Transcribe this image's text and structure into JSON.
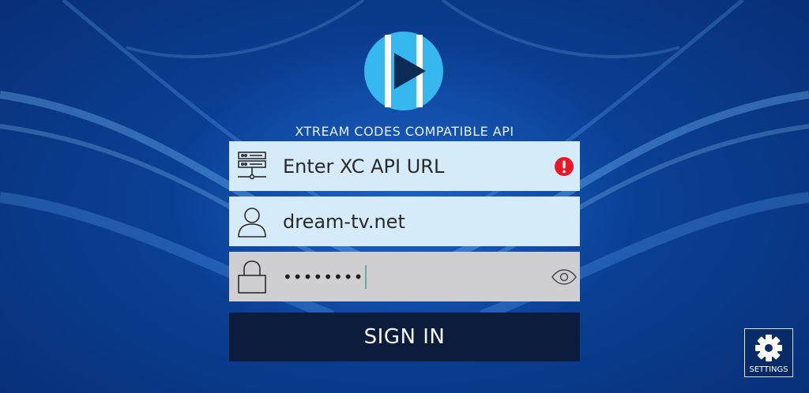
{
  "app": {
    "api_title": "XTREAM CODES COMPATIBLE API",
    "logo_icon": "play-logo-icon"
  },
  "fields": {
    "url": {
      "placeholder": "Enter XC API URL",
      "value": "",
      "icon": "server-icon",
      "status_icon": "error-icon"
    },
    "username": {
      "value": "dream-tv.net",
      "icon": "user-icon"
    },
    "password": {
      "masked_value": "••••••••",
      "icon": "lock-icon",
      "toggle_icon": "eye-icon"
    }
  },
  "actions": {
    "sign_in_label": "SIGN IN",
    "settings_label": "SETTINGS"
  },
  "colors": {
    "background": "#0a3f93",
    "field_light": "#d6ebf9",
    "field_disabled": "#cfcfd1",
    "button": "#0b1c3d",
    "error": "#e8182c",
    "logo": "#36b7ee"
  }
}
